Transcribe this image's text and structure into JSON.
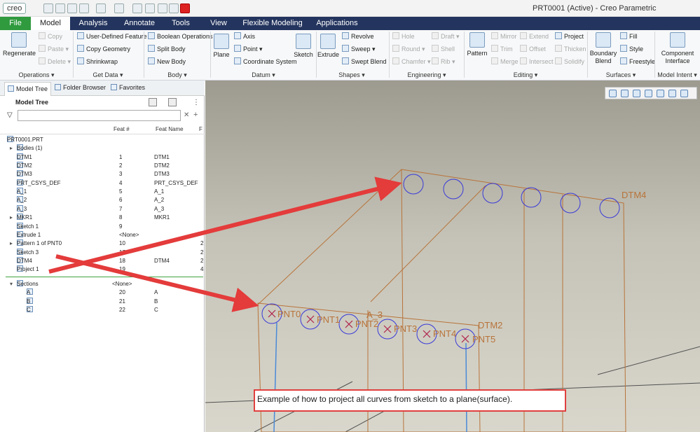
{
  "app": {
    "logo": "creo",
    "window_title": "PRT0001 (Active) - Creo Parametric"
  },
  "ribbon_tabs": [
    "File",
    "Model",
    "Analysis",
    "Annotate",
    "Tools",
    "View",
    "Flexible Modeling",
    "Applications"
  ],
  "ribbon": {
    "operations": {
      "label": "Operations ▾",
      "regenerate": "Regenerate",
      "copy": "Copy",
      "paste": "Paste ▾",
      "delete": "Delete ▾"
    },
    "get_data": {
      "label": "Get Data ▾",
      "udf": "User-Defined Feature",
      "copy_geometry": "Copy Geometry",
      "shrinkwrap": "Shrinkwrap"
    },
    "body": {
      "label": "Body ▾",
      "boolean": "Boolean Operations",
      "split": "Split Body",
      "new": "New Body"
    },
    "datum": {
      "label": "Datum ▾",
      "plane": "Plane",
      "axis": "Axis",
      "point": "Point ▾",
      "csys": "Coordinate System",
      "sketch": "Sketch"
    },
    "shapes": {
      "label": "Shapes ▾",
      "extrude": "Extrude",
      "revolve": "Revolve",
      "sweep": "Sweep ▾",
      "swept_blend": "Swept Blend"
    },
    "engineering": {
      "label": "Engineering ▾",
      "hole": "Hole",
      "round": "Round ▾",
      "chamfer": "Chamfer ▾",
      "draft": "Draft ▾",
      "shell": "Shell",
      "rib": "Rib ▾"
    },
    "editing": {
      "label": "Editing ▾",
      "pattern": "Pattern",
      "mirror": "Mirror",
      "trim": "Trim",
      "merge": "Merge",
      "extend": "Extend",
      "offset": "Offset",
      "intersect": "Intersect",
      "project": "Project",
      "thicken": "Thicken",
      "solidify": "Solidify"
    },
    "surfaces": {
      "label": "Surfaces ▾",
      "boundary_blend": "Boundary Blend",
      "fill": "Fill",
      "style": "Style",
      "freestyle": "Freestyle"
    },
    "model_intent": {
      "label": "Model Intent ▾",
      "component_interface": "Component Interface"
    }
  },
  "panel": {
    "tabs": [
      "Model Tree",
      "Folder Browser",
      "Favorites"
    ],
    "heading": "Model Tree",
    "columns": {
      "feat_num": "Feat #",
      "feat_name": "Feat Name",
      "extra": "F"
    },
    "rows": [
      {
        "name": "PRT0001.PRT",
        "num": "",
        "fname": "",
        "extra": ""
      },
      {
        "name": "Bodies (1)",
        "num": "",
        "fname": "",
        "extra": ""
      },
      {
        "name": "DTM1",
        "num": "1",
        "fname": "DTM1",
        "extra": ""
      },
      {
        "name": "DTM2",
        "num": "2",
        "fname": "DTM2",
        "extra": ""
      },
      {
        "name": "DTM3",
        "num": "3",
        "fname": "DTM3",
        "extra": ""
      },
      {
        "name": "PRT_CSYS_DEF",
        "num": "4",
        "fname": "PRT_CSYS_DEF",
        "extra": ""
      },
      {
        "name": "A_1",
        "num": "5",
        "fname": "A_1",
        "extra": ""
      },
      {
        "name": "A_2",
        "num": "6",
        "fname": "A_2",
        "extra": ""
      },
      {
        "name": "A_3",
        "num": "7",
        "fname": "A_3",
        "extra": ""
      },
      {
        "name": "MKR1",
        "num": "8",
        "fname": "MKR1",
        "extra": ""
      },
      {
        "name": "Sketch 1",
        "num": "9",
        "fname": "",
        "extra": ""
      },
      {
        "name": "Extrude 1",
        "num": "<None>",
        "fname": "",
        "extra": ""
      },
      {
        "name": "Pattern 1 of PNT0",
        "num": "10",
        "fname": "",
        "extra": "2"
      },
      {
        "name": "Sketch 3",
        "num": "17",
        "fname": "",
        "extra": "2"
      },
      {
        "name": "DTM4",
        "num": "18",
        "fname": "DTM4",
        "extra": "2"
      },
      {
        "name": "Project 1",
        "num": "19",
        "fname": "",
        "extra": "4"
      }
    ],
    "sections": [
      {
        "name": "Sections",
        "num": "<None>",
        "fname": ""
      },
      {
        "name": "A",
        "num": "20",
        "fname": "A"
      },
      {
        "name": "B",
        "num": "21",
        "fname": "B"
      },
      {
        "name": "C",
        "num": "22",
        "fname": "C"
      }
    ]
  },
  "viewport": {
    "labels": {
      "dtm4": "DTM4",
      "dtm2": "DTM2",
      "a3": "A_3"
    },
    "points": [
      "PNT0",
      "PNT1",
      "PNT2",
      "PNT3",
      "PNT4",
      "PNT5"
    ]
  },
  "annotation": "Example of how to project all curves from sketch to a plane(surface)."
}
